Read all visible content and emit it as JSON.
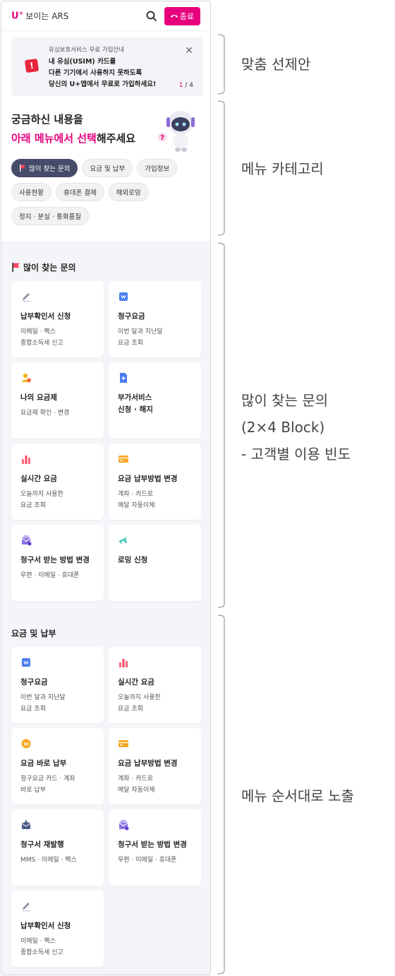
{
  "header": {
    "logo_mark": "U",
    "logo_sup": "+",
    "title": "보이는 ARS",
    "end_label": "종료"
  },
  "notice": {
    "sub": "유심보호서비스 무료 가입안내",
    "message": "내 유심(USIM) 카드를\n다른 기기에서 사용하지 못하도록\n당신의 U+앱에서 무료로 가입하세요!",
    "pager_current": "1",
    "pager_total": " / 4"
  },
  "intro": {
    "line1": "궁금하신 내용을",
    "line2_highlight": "아래 메뉴에서 선택",
    "line2_rest": "해주세요"
  },
  "chips": [
    "많이 찾는 문의",
    "요금 및 납부",
    "가입정보",
    "사용현황",
    "휴대폰 결제",
    "해외로밍",
    "정지 · 분실 · 통화품질"
  ],
  "popular": {
    "title": "많이 찾는 문의",
    "cards": [
      {
        "title": "납부확인서 신청",
        "desc": "이메일 · 팩스\n종합소득세 신고",
        "icon": "pencil-icon"
      },
      {
        "title": "청구요금",
        "desc": "이번 달과 지난달\n요금 조회",
        "icon": "bill-icon"
      },
      {
        "title": "나의 요금제",
        "desc": "요금제 확인 · 변경",
        "icon": "person-icon"
      },
      {
        "title": "부가서비스\n신청 · 해지",
        "desc": "",
        "icon": "doc-plus-icon"
      },
      {
        "title": "실시간 요금",
        "desc": "오늘까지 사용한\n요금 조회",
        "icon": "bar-chart-icon"
      },
      {
        "title": "요금 납부방법 변경",
        "desc": "계좌 · 카드로\n매달 자동이체",
        "icon": "card-icon"
      },
      {
        "title": "청구서 받는 방법 변경",
        "desc": "우편 · 이메일 · 휴대폰",
        "icon": "mail-icon"
      },
      {
        "title": "로밍 신청",
        "desc": "",
        "icon": "plane-icon"
      }
    ]
  },
  "billing": {
    "title": "요금 및 납부",
    "cards": [
      {
        "title": "청구요금",
        "desc": "이번 달과 지난달\n요금 조회",
        "icon": "bill-icon"
      },
      {
        "title": "실시간 요금",
        "desc": "오늘까지 사용한\n요금 조회",
        "icon": "bar-chart-icon"
      },
      {
        "title": "요금 바로 납부",
        "desc": "청구요금 카드 · 계좌\n바로 납부",
        "icon": "coin-icon"
      },
      {
        "title": "요금 납부방법 변경",
        "desc": "계좌 · 카드로\n매달 자동이체",
        "icon": "card-icon"
      },
      {
        "title": "청구서 재발행",
        "desc": "MMS · 이메일 · 팩스",
        "icon": "reissue-icon"
      },
      {
        "title": "청구서 받는 방법 변경",
        "desc": "우편 · 이메일 · 휴대폰",
        "icon": "mail-icon"
      },
      {
        "title": "납부확인서 신청",
        "desc": "이메일 · 팩스\n종합소득세 신고",
        "icon": "pencil-icon"
      }
    ]
  },
  "annotations": [
    "맞춤 선제안",
    "메뉴 카테고리",
    "많이 찾는 문의\n(2×4 Block)\n- 고객별 이용 빈도",
    "메뉴 순서대로 노출"
  ],
  "colors": {
    "brand": "#e6007e",
    "chip_active": "#454b68",
    "section_bg": "#f4f5f8"
  }
}
